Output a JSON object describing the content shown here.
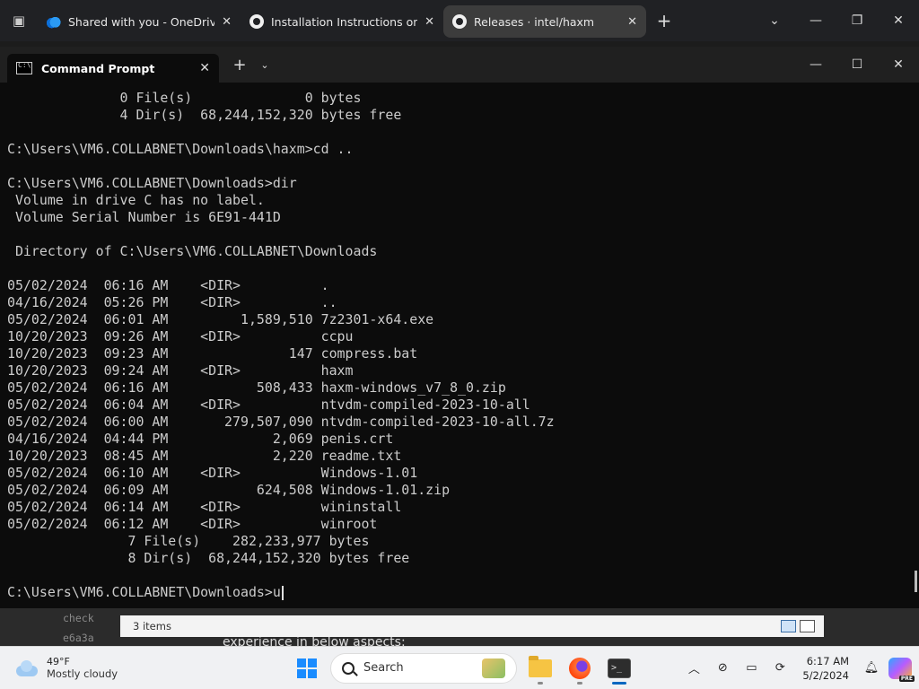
{
  "browser": {
    "tabs": [
      {
        "label": "Shared with you - OneDrive",
        "icon": "onedrive-icon",
        "active": false
      },
      {
        "label": "Installation Instructions on Win",
        "icon": "github-icon",
        "active": false
      },
      {
        "label": "Releases · intel/haxm",
        "icon": "github-icon",
        "active": true
      }
    ],
    "new_tab_glyph": "+",
    "tab_list_glyph": "⌄"
  },
  "terminal": {
    "tab_title": "Command Prompt",
    "new_tab_glyph": "+",
    "dropdown_glyph": "⌄",
    "lines": [
      "              0 File(s)              0 bytes",
      "              4 Dir(s)  68,244,152,320 bytes free",
      "",
      "C:\\Users\\VM6.COLLABNET\\Downloads\\haxm>cd ..",
      "",
      "C:\\Users\\VM6.COLLABNET\\Downloads>dir",
      " Volume in drive C has no label.",
      " Volume Serial Number is 6E91-441D",
      "",
      " Directory of C:\\Users\\VM6.COLLABNET\\Downloads",
      "",
      "05/02/2024  06:16 AM    <DIR>          .",
      "04/16/2024  05:26 PM    <DIR>          ..",
      "05/02/2024  06:01 AM         1,589,510 7z2301-x64.exe",
      "10/20/2023  09:26 AM    <DIR>          ccpu",
      "10/20/2023  09:23 AM               147 compress.bat",
      "10/20/2023  09:24 AM    <DIR>          haxm",
      "05/02/2024  06:16 AM           508,433 haxm-windows_v7_8_0.zip",
      "05/02/2024  06:04 AM    <DIR>          ntvdm-compiled-2023-10-all",
      "05/02/2024  06:00 AM       279,507,090 ntvdm-compiled-2023-10-all.7z",
      "04/16/2024  04:44 PM             2,069 penis.crt",
      "10/20/2023  08:45 AM             2,220 readme.txt",
      "05/02/2024  06:10 AM    <DIR>          Windows-1.01",
      "05/02/2024  06:09 AM           624,508 Windows-1.01.zip",
      "05/02/2024  06:14 AM    <DIR>          wininstall",
      "05/02/2024  06:12 AM    <DIR>          winroot",
      "               7 File(s)    282,233,977 bytes",
      "               8 Dir(s)  68,244,152,320 bytes free",
      ""
    ],
    "prompt": "C:\\Users\\VM6.COLLABNET\\Downloads>u"
  },
  "explorer": {
    "status_items": "3 items",
    "behind_left_1": "check",
    "behind_left_2": "e6a3a",
    "behind_text": "experience in below aspects:"
  },
  "taskbar": {
    "weather_temp": "49°F",
    "weather_desc": "Mostly cloudy",
    "search_label": "Search",
    "time": "6:17 AM",
    "date": "5/2/2024",
    "copilot_badge": "PRE",
    "accent_color": "#0067c0"
  }
}
